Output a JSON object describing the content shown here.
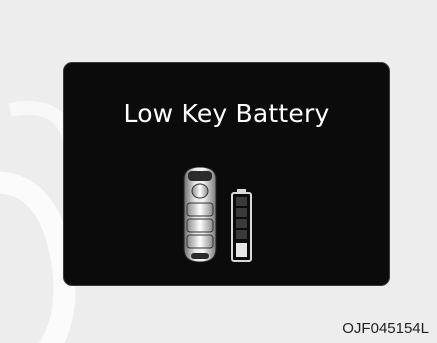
{
  "display": {
    "message": "Low Key Battery",
    "background_color": "#0b0b0b",
    "text_color": "#ffffff"
  },
  "icons": {
    "key_fob": "smart-key-fob-icon",
    "battery": "low-battery-icon",
    "battery_level_fraction": 0.2
  },
  "figure": {
    "code": "OJF045154L"
  }
}
